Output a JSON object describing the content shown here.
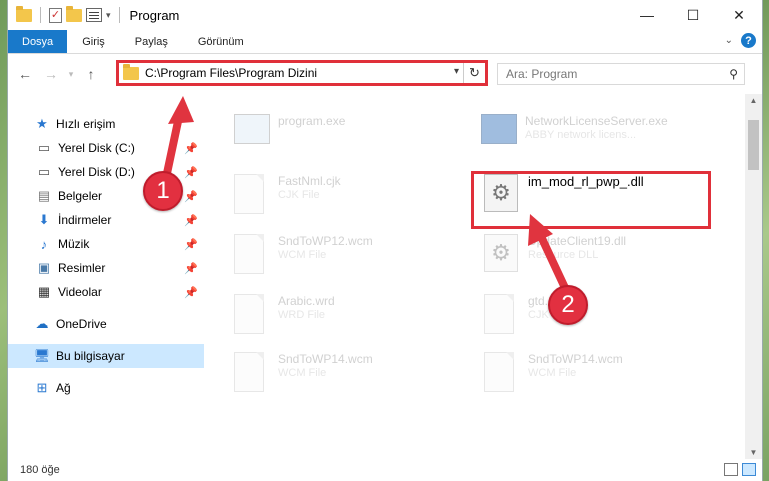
{
  "window": {
    "title": "Program"
  },
  "ribbon": {
    "tabs": [
      "Dosya",
      "Giriş",
      "Paylaş",
      "Görünüm"
    ]
  },
  "nav": {
    "address_path": "C:\\Program Files\\Program Dizini",
    "search_placeholder": "Ara: Program"
  },
  "sidebar": {
    "quick_access": "Hızlı erişim",
    "items": [
      {
        "label": "Yerel Disk (C:)",
        "icon": "drive-icon"
      },
      {
        "label": "Yerel Disk (D:)",
        "icon": "drive-icon"
      },
      {
        "label": "Belgeler",
        "icon": "documents-icon"
      },
      {
        "label": "İndirmeler",
        "icon": "download-icon"
      },
      {
        "label": "Müzik",
        "icon": "music-icon"
      },
      {
        "label": "Resimler",
        "icon": "pictures-icon"
      },
      {
        "label": "Videolar",
        "icon": "videos-icon"
      }
    ],
    "onedrive": "OneDrive",
    "this_pc": "Bu bilgisayar",
    "network": "Ağ"
  },
  "files": [
    {
      "name": "program.exe",
      "type": ""
    },
    {
      "name": "NetworkLicenseServer.exe",
      "type": "ABBY network licens..."
    },
    {
      "name": "FastNml.cjk",
      "type": "CJK File"
    },
    {
      "name": "im_mod_rl_pwp_.dll",
      "type": ""
    },
    {
      "name": "SndToWP12.wcm",
      "type": "WCM File"
    },
    {
      "name": "UpdateClient19.dll",
      "type": "Resource DLL"
    },
    {
      "name": "Arabic.wrd",
      "type": "WRD File"
    },
    {
      "name": "gtd.cjk",
      "type": "CJK File"
    },
    {
      "name": "SndToWP14.wcm",
      "type": "WCM File"
    },
    {
      "name": "SndToWP14.wcm",
      "type": "WCM File"
    }
  ],
  "status": {
    "count": "180 öğe"
  },
  "annotations": {
    "step1": "1",
    "step2": "2"
  },
  "colors": {
    "accent": "#1979ca",
    "highlight": "#e0303a",
    "selected": "#cce8ff"
  }
}
